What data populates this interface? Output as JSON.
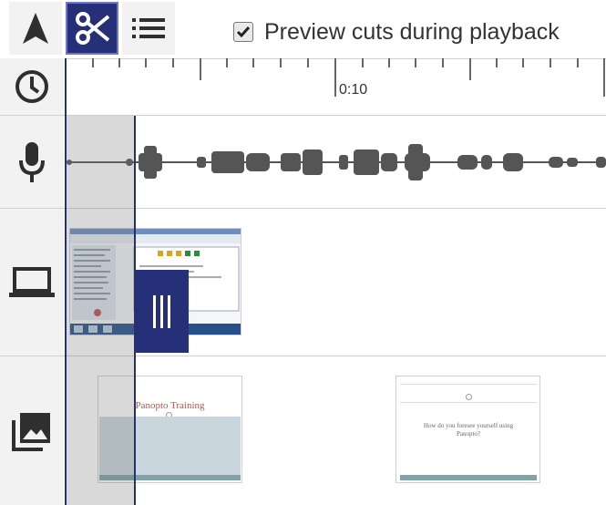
{
  "toolbar": {
    "tools": [
      {
        "name": "select-tool",
        "icon": "arrow-pointer-icon",
        "active": false
      },
      {
        "name": "cut-tool",
        "icon": "scissors-icon",
        "active": true
      },
      {
        "name": "list-tool",
        "icon": "list-icon",
        "active": false
      }
    ],
    "preview_label": "Preview cuts during playback",
    "preview_checked": true
  },
  "tracks": {
    "timeline": {
      "icon": "clock-icon",
      "tick_label": "0:10"
    },
    "audio": {
      "icon": "microphone-icon"
    },
    "screen": {
      "icon": "laptop-icon"
    },
    "slides": {
      "icon": "images-icon"
    }
  },
  "slides": [
    {
      "title": "Panopto Training"
    },
    {
      "question": "How do you foresee yourself using Panopto?"
    }
  ],
  "colors": {
    "accent": "#263078",
    "accent_border": "#6f78c8",
    "slide_title": "#c0504d",
    "slide_band": "#c9d6dd",
    "slide_footer": "#7fa3a6"
  }
}
